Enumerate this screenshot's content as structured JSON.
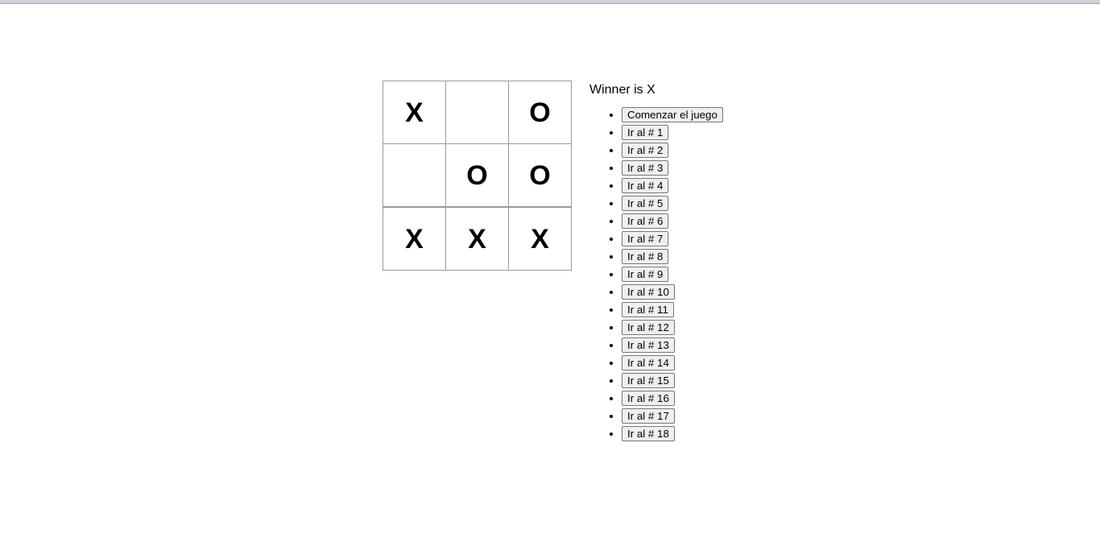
{
  "page": {
    "background_color": "#ffffff",
    "chrome_strip_color": "#cdd1d9"
  },
  "game": {
    "status": "Winner is X",
    "board": {
      "rows": [
        [
          "X",
          "",
          "O"
        ],
        [
          "",
          "O",
          "O"
        ],
        [
          "X",
          "X",
          "X"
        ]
      ]
    },
    "moves": [
      {
        "label": "Comenzar el juego"
      },
      {
        "label": "Ir al # 1"
      },
      {
        "label": "Ir al # 2"
      },
      {
        "label": "Ir al # 3"
      },
      {
        "label": "Ir al # 4"
      },
      {
        "label": "Ir al # 5"
      },
      {
        "label": "Ir al # 6"
      },
      {
        "label": "Ir al # 7"
      },
      {
        "label": "Ir al # 8"
      },
      {
        "label": "Ir al # 9"
      },
      {
        "label": "Ir al # 10"
      },
      {
        "label": "Ir al # 11"
      },
      {
        "label": "Ir al # 12"
      },
      {
        "label": "Ir al # 13"
      },
      {
        "label": "Ir al # 14"
      },
      {
        "label": "Ir al # 15"
      },
      {
        "label": "Ir al # 16"
      },
      {
        "label": "Ir al # 17"
      },
      {
        "label": "Ir al # 18"
      }
    ]
  }
}
